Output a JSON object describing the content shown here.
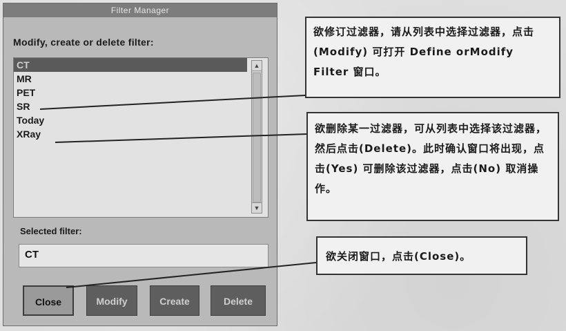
{
  "dialog": {
    "title": "Filter Manager",
    "prompt": "Modify, create or delete filter:",
    "filters": [
      "CT",
      "MR",
      "PET",
      "SR",
      "Today",
      "XRay"
    ],
    "selected_index": 0,
    "scroll_up": "▲",
    "scroll_down": "▼",
    "selected_label": "Selected filter:",
    "selected_value": "CT",
    "buttons": {
      "close": "Close",
      "modify": "Modify",
      "create": "Create",
      "delete": "Delete"
    }
  },
  "callouts": {
    "modify": "欲修订过滤器，请从列表中选择过滤器，点击 (Modify) 可打开 Define orModify Filter 窗口。",
    "delete": "欲删除某一过滤器，可从列表中选择该过滤器，然后点击(Delete)。此时确认窗口将出现，点击(Yes) 可删除该过滤器，点击(No) 取消操作。",
    "close": "欲关闭窗口，点击(Close)。"
  }
}
